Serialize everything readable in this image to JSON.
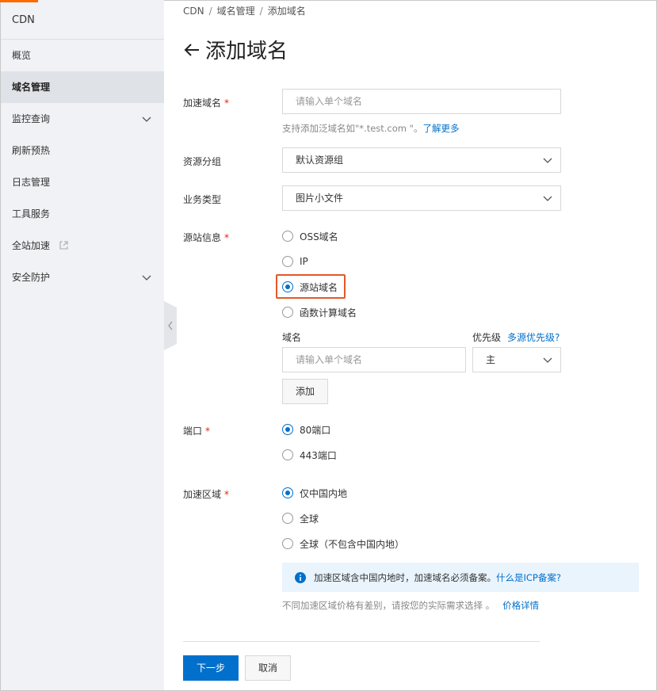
{
  "sidebar": {
    "title": "CDN",
    "items": [
      {
        "label": "概览"
      },
      {
        "label": "域名管理"
      },
      {
        "label": "监控查询"
      },
      {
        "label": "刷新预热"
      },
      {
        "label": "日志管理"
      },
      {
        "label": "工具服务"
      },
      {
        "label": "全站加速"
      },
      {
        "label": "安全防护"
      }
    ]
  },
  "breadcrumb": {
    "items": [
      "CDN",
      "域名管理",
      "添加域名"
    ],
    "separator": "/"
  },
  "page_title": "添加域名",
  "form": {
    "domain": {
      "label": "加速域名",
      "required_mark": "*",
      "placeholder": "请输入单个域名",
      "help_text": "支持添加泛域名如\"*.test.com \"。",
      "help_link": "了解更多"
    },
    "resource_group": {
      "label": "资源分组",
      "value": "默认资源组"
    },
    "business_type": {
      "label": "业务类型",
      "value": "图片小文件"
    },
    "origin": {
      "label": "源站信息",
      "required_mark": "*",
      "options": [
        "OSS域名",
        "IP",
        "源站域名",
        "函数计算域名"
      ],
      "selected": "源站域名",
      "domain_col_label": "域名",
      "priority_label": "优先级",
      "priority_link": "多源优先级?",
      "domain_placeholder": "请输入单个域名",
      "priority_value": "主",
      "add_button": "添加"
    },
    "port": {
      "label": "端口",
      "required_mark": "*",
      "options": [
        "80端口",
        "443端口"
      ],
      "selected": "80端口"
    },
    "region": {
      "label": "加速区域",
      "required_mark": "*",
      "options": [
        "仅中国内地",
        "全球",
        "全球（不包含中国内地）"
      ],
      "selected": "仅中国内地",
      "notice_text": "加速区域含中国内地时，加速域名必须备案。",
      "notice_link": "什么是ICP备案?",
      "price_text": "不同加速区域价格有差别，请按您的实际需求选择 。",
      "price_link": "价格详情"
    }
  },
  "footer": {
    "next_button": "下一步",
    "cancel_button": "取消"
  },
  "colors": {
    "primary": "#0070cc",
    "highlight": "#e3582b",
    "required": "#e2231a",
    "accent_strip": "#ff6a00"
  }
}
